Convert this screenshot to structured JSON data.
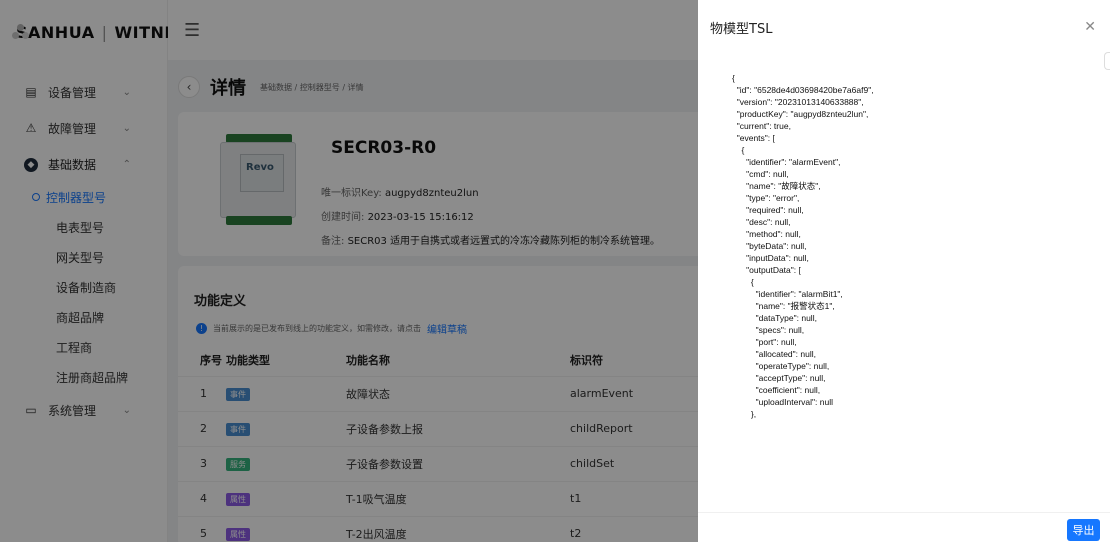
{
  "app": {
    "logo_brand": "SANHUA",
    "logo_product": "WITNESS"
  },
  "sidebar": {
    "items": [
      {
        "icon": "calendar-icon",
        "label": "设备管理"
      },
      {
        "icon": "warning-icon",
        "label": "故障管理"
      },
      {
        "icon": "database-icon",
        "label": "基础数据"
      },
      {
        "icon": "monitor-icon",
        "label": "系统管理"
      }
    ],
    "sub_items": [
      "控制器型号",
      "电表型号",
      "网关型号",
      "设备制造商",
      "商超品牌",
      "工程商",
      "注册商超品牌"
    ]
  },
  "page": {
    "title": "详情",
    "breadcrumb": "基础数据 / 控制器型号 / 详情"
  },
  "product": {
    "brand_on_device": "Revo",
    "model": "SECR03-R0",
    "key_label": "唯一标识Key:",
    "key_value": "augpyd8znteu2lun",
    "created_label": "创建时间:",
    "created_value": "2023-03-15 15:16:12",
    "remark_label": "备注:",
    "remark_value": "SECR03 适用于自携式或者远置式的冷冻冷藏陈列柜的制冷系统管理。"
  },
  "functions": {
    "title": "功能定义",
    "notice_text": "当前展示的是已发布到线上的功能定义，如需修改，请点击",
    "notice_link": "编辑草稿",
    "columns": [
      "序号",
      "功能类型",
      "功能名称",
      "标识符"
    ],
    "rows": [
      {
        "no": "1",
        "type": "事件",
        "type_kind": "event",
        "name": "故障状态",
        "id": "alarmEvent"
      },
      {
        "no": "2",
        "type": "事件",
        "type_kind": "event",
        "name": "子设备参数上报",
        "id": "childReport"
      },
      {
        "no": "3",
        "type": "服务",
        "type_kind": "service",
        "name": "子设备参数设置",
        "id": "childSet"
      },
      {
        "no": "4",
        "type": "属性",
        "type_kind": "prop",
        "name": "T-1吸气温度",
        "id": "t1"
      },
      {
        "no": "5",
        "type": "属性",
        "type_kind": "prop",
        "name": "T-2出风温度",
        "id": "t2"
      }
    ]
  },
  "drawer": {
    "title": "物模型TSL",
    "export_label": "导出",
    "tsl_lines": [
      "{",
      "  \"id\": \"6528de4d03698420be7a6af9\",",
      "  \"version\": \"20231013140633888\",",
      "  \"productKey\": \"augpyd8znteu2lun\",",
      "  \"current\": true,",
      "  \"events\": [",
      "    {",
      "      \"identifier\": \"alarmEvent\",",
      "      \"cmd\": null,",
      "      \"name\": \"故障状态\",",
      "      \"type\": \"error\",",
      "      \"required\": null,",
      "      \"desc\": null,",
      "      \"method\": null,",
      "      \"byteData\": null,",
      "      \"inputData\": null,",
      "      \"outputData\": [",
      "        {",
      "          \"identifier\": \"alarmBit1\",",
      "          \"name\": \"报警状态1\",",
      "          \"dataType\": null,",
      "          \"specs\": null,",
      "          \"port\": null,",
      "          \"allocated\": null,",
      "          \"operateType\": null,",
      "          \"acceptType\": null,",
      "          \"coefficient\": null,",
      "          \"uploadInterval\": null",
      "        },"
    ]
  },
  "colors": {
    "primary": "#1677ff",
    "mask": "rgba(0,0,0,0.45)"
  }
}
